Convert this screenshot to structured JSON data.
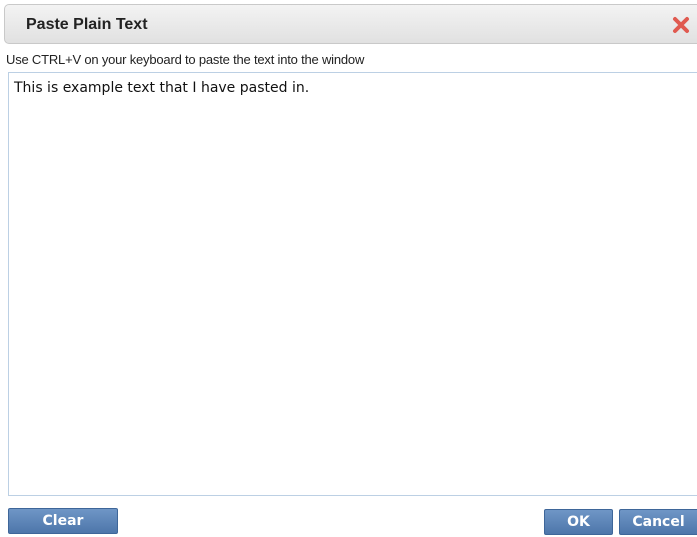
{
  "dialog": {
    "title": "Paste Plain Text",
    "close_icon": "close-x-icon",
    "close_color": "#e05a50"
  },
  "instructions": "Use CTRL+V on your keyboard to paste the text into the window",
  "paste_area": {
    "value": "This is example text that I have pasted in."
  },
  "buttons": {
    "clear": "Clear",
    "ok": "OK",
    "cancel": "Cancel",
    "color": "#5a82b6"
  }
}
